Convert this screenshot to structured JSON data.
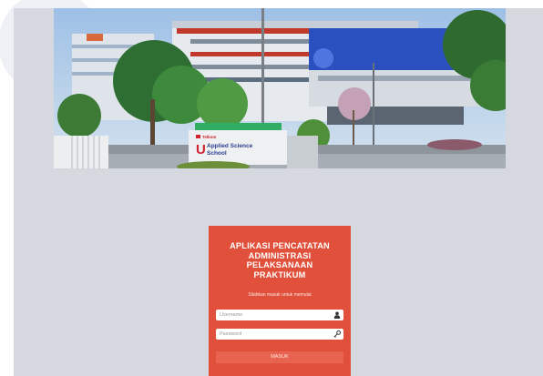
{
  "hero": {
    "sign_brand": "Telkom",
    "sign_line1": "Applied Science",
    "sign_line2": "School"
  },
  "login": {
    "title_lines": [
      "APLIKASI PENCATATAN",
      "ADMINISTRASI",
      "PELAKSANAAN",
      "PRAKTIKUM"
    ],
    "subtitle": "Silahkan masuk untuk memulai",
    "username_placeholder": "Username",
    "password_placeholder": "Password",
    "submit_label": "MASUK",
    "username_icon": "user-icon",
    "password_icon": "key-icon"
  },
  "colors": {
    "card_background": "#e0503a",
    "button_background": "#e86450",
    "content_background": "#d5d8df"
  }
}
